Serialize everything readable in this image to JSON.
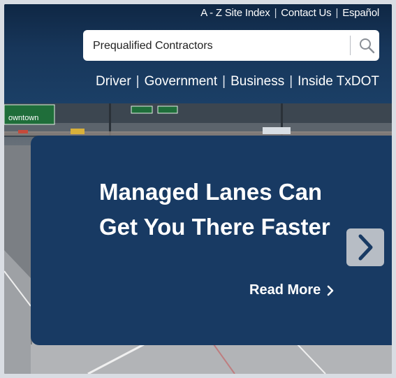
{
  "utility_nav": {
    "site_index": "A - Z Site Index",
    "contact_us": "Contact Us",
    "espanol": "Español",
    "separator": "|"
  },
  "search": {
    "value": "Prequalified Contractors",
    "icon": "search-icon"
  },
  "main_nav": {
    "items": [
      {
        "label": "Driver"
      },
      {
        "label": "Government"
      },
      {
        "label": "Business"
      },
      {
        "label": "Inside TxDOT"
      }
    ],
    "separator": "|"
  },
  "hero": {
    "headline_line1": "Managed Lanes Can",
    "headline_line2": "Get You There Faster",
    "read_more": "Read More",
    "next_icon": "chevron-right-icon",
    "signs": [
      "owntown"
    ]
  },
  "colors": {
    "header_bg": "#17365a",
    "panel_bg": "#183a63",
    "next_button_bg": "#b7bdc5",
    "chevron": "#183a63"
  }
}
